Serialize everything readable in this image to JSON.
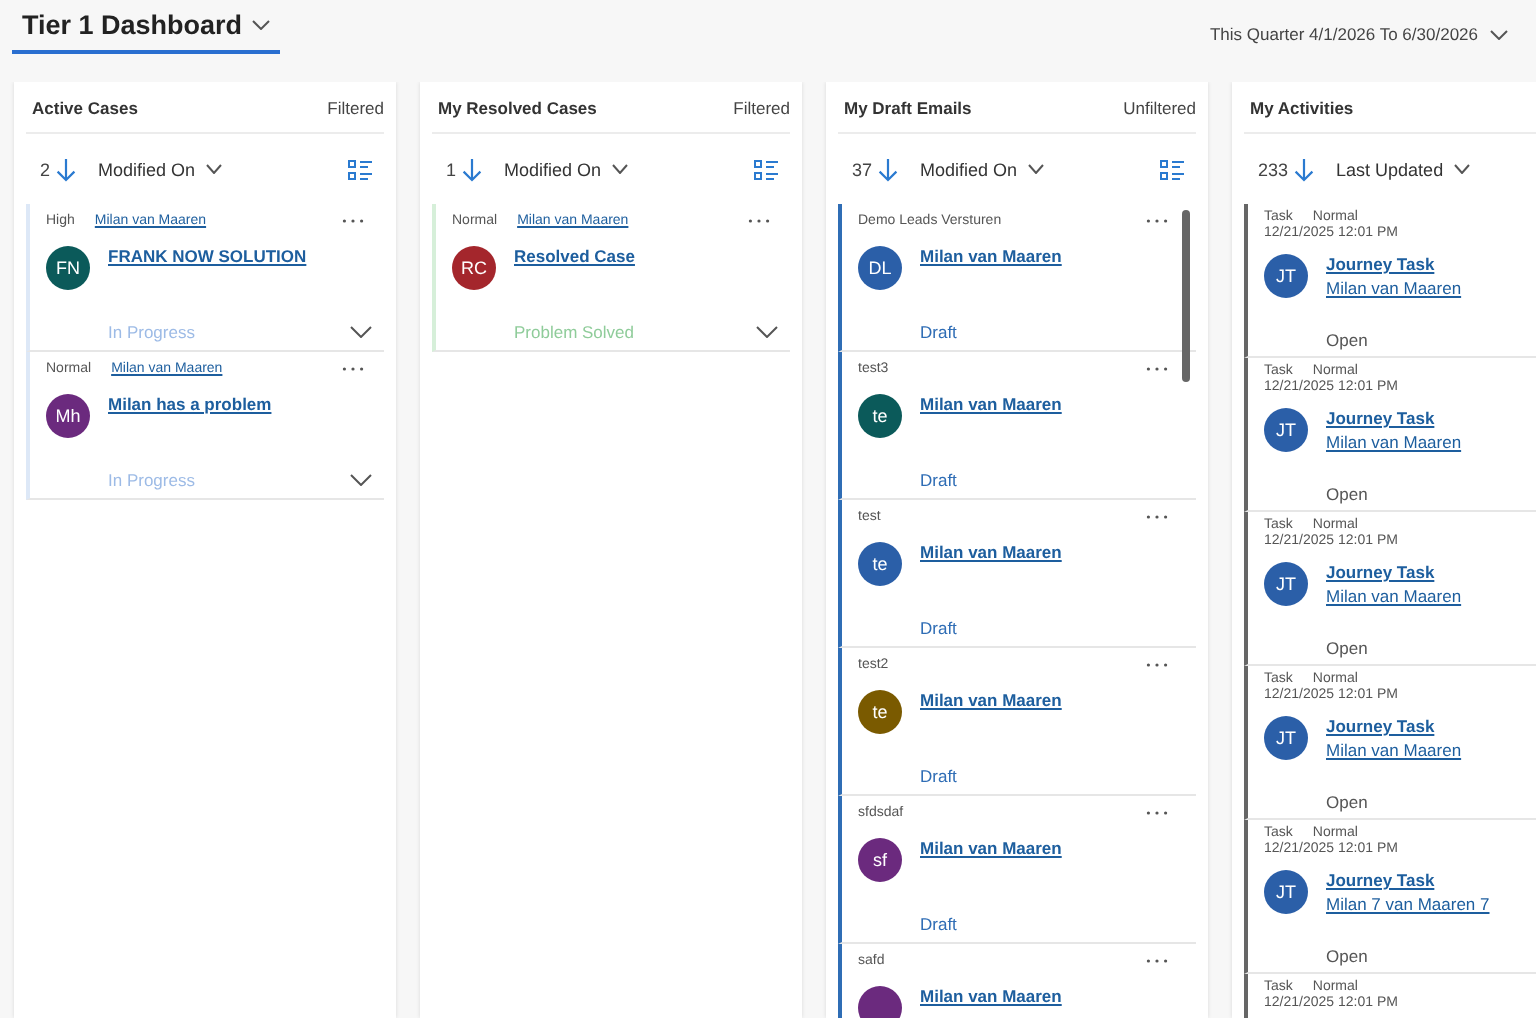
{
  "header": {
    "title": "Tier 1 Dashboard",
    "date_filter": "This Quarter 4/1/2026 To 6/30/2026"
  },
  "panels": [
    {
      "kind": "case",
      "title": "Active Cases",
      "filter": "Filtered",
      "count": "2",
      "sort_field": "Modified On",
      "cards": [
        {
          "meta": "High",
          "owner": "Milan van Maaren",
          "initials": "FN",
          "color": "#0b5a5a",
          "title": "FRANK NOW SOLUTION",
          "status": "In Progress"
        },
        {
          "meta": "Normal",
          "owner": "Milan van Maaren",
          "initials": "Mh",
          "color": "#6b2a7e",
          "title": "Milan has a problem",
          "status": "In Progress"
        }
      ]
    },
    {
      "kind": "resolved",
      "title": "My Resolved Cases",
      "filter": "Filtered",
      "count": "1",
      "sort_field": "Modified On",
      "cards": [
        {
          "meta": "Normal",
          "owner": "Milan van Maaren",
          "initials": "RC",
          "color": "#a4262c",
          "title": "Resolved Case",
          "status": "Problem Solved"
        }
      ]
    },
    {
      "kind": "email",
      "title": "My Draft Emails",
      "filter": "Unfiltered",
      "count": "37",
      "sort_field": "Modified On",
      "cards": [
        {
          "meta": "Demo Leads Versturen",
          "initials": "DL",
          "color": "#2b5fa8",
          "title": "Milan van Maaren",
          "status": "Draft"
        },
        {
          "meta": "test3",
          "initials": "te",
          "color": "#0b5a5a",
          "title": "Milan van Maaren",
          "status": "Draft"
        },
        {
          "meta": "test",
          "initials": "te",
          "color": "#2b5fa8",
          "title": "Milan van Maaren",
          "status": "Draft"
        },
        {
          "meta": "test2",
          "initials": "te",
          "color": "#7a5a00",
          "title": "Milan van Maaren",
          "status": "Draft"
        },
        {
          "meta": "sfdsdaf",
          "initials": "sf",
          "color": "#6b2a7e",
          "title": "Milan van Maaren",
          "status": "Draft"
        },
        {
          "meta": "safd",
          "color": "#6b2a7e",
          "title": "Milan van Maaren"
        }
      ]
    },
    {
      "kind": "activity",
      "title": "My Activities",
      "count": "233",
      "sort_field": "Last Updated",
      "cards": [
        {
          "meta": "Task",
          "priority": "Normal",
          "date": "12/21/2025 12:01 PM",
          "initials": "JT",
          "color": "#2b5fa8",
          "title": "Journey Task",
          "owner": "Milan van Maaren",
          "status": "Open"
        },
        {
          "meta": "Task",
          "priority": "Normal",
          "date": "12/21/2025 12:01 PM",
          "initials": "JT",
          "color": "#2b5fa8",
          "title": "Journey Task",
          "owner": "Milan van Maaren",
          "status": "Open"
        },
        {
          "meta": "Task",
          "priority": "Normal",
          "date": "12/21/2025 12:01 PM",
          "initials": "JT",
          "color": "#2b5fa8",
          "title": "Journey Task",
          "owner": "Milan van Maaren",
          "status": "Open"
        },
        {
          "meta": "Task",
          "priority": "Normal",
          "date": "12/21/2025 12:01 PM",
          "initials": "JT",
          "color": "#2b5fa8",
          "title": "Journey Task",
          "owner": "Milan van Maaren",
          "status": "Open"
        },
        {
          "meta": "Task",
          "priority": "Normal",
          "date": "12/21/2025 12:01 PM",
          "initials": "JT",
          "color": "#2b5fa8",
          "title": "Journey Task",
          "owner": "Milan 7 van Maaren 7",
          "status": "Open"
        },
        {
          "meta": "Task",
          "priority": "Normal",
          "date": "12/21/2025 12:01 PM"
        }
      ]
    }
  ]
}
